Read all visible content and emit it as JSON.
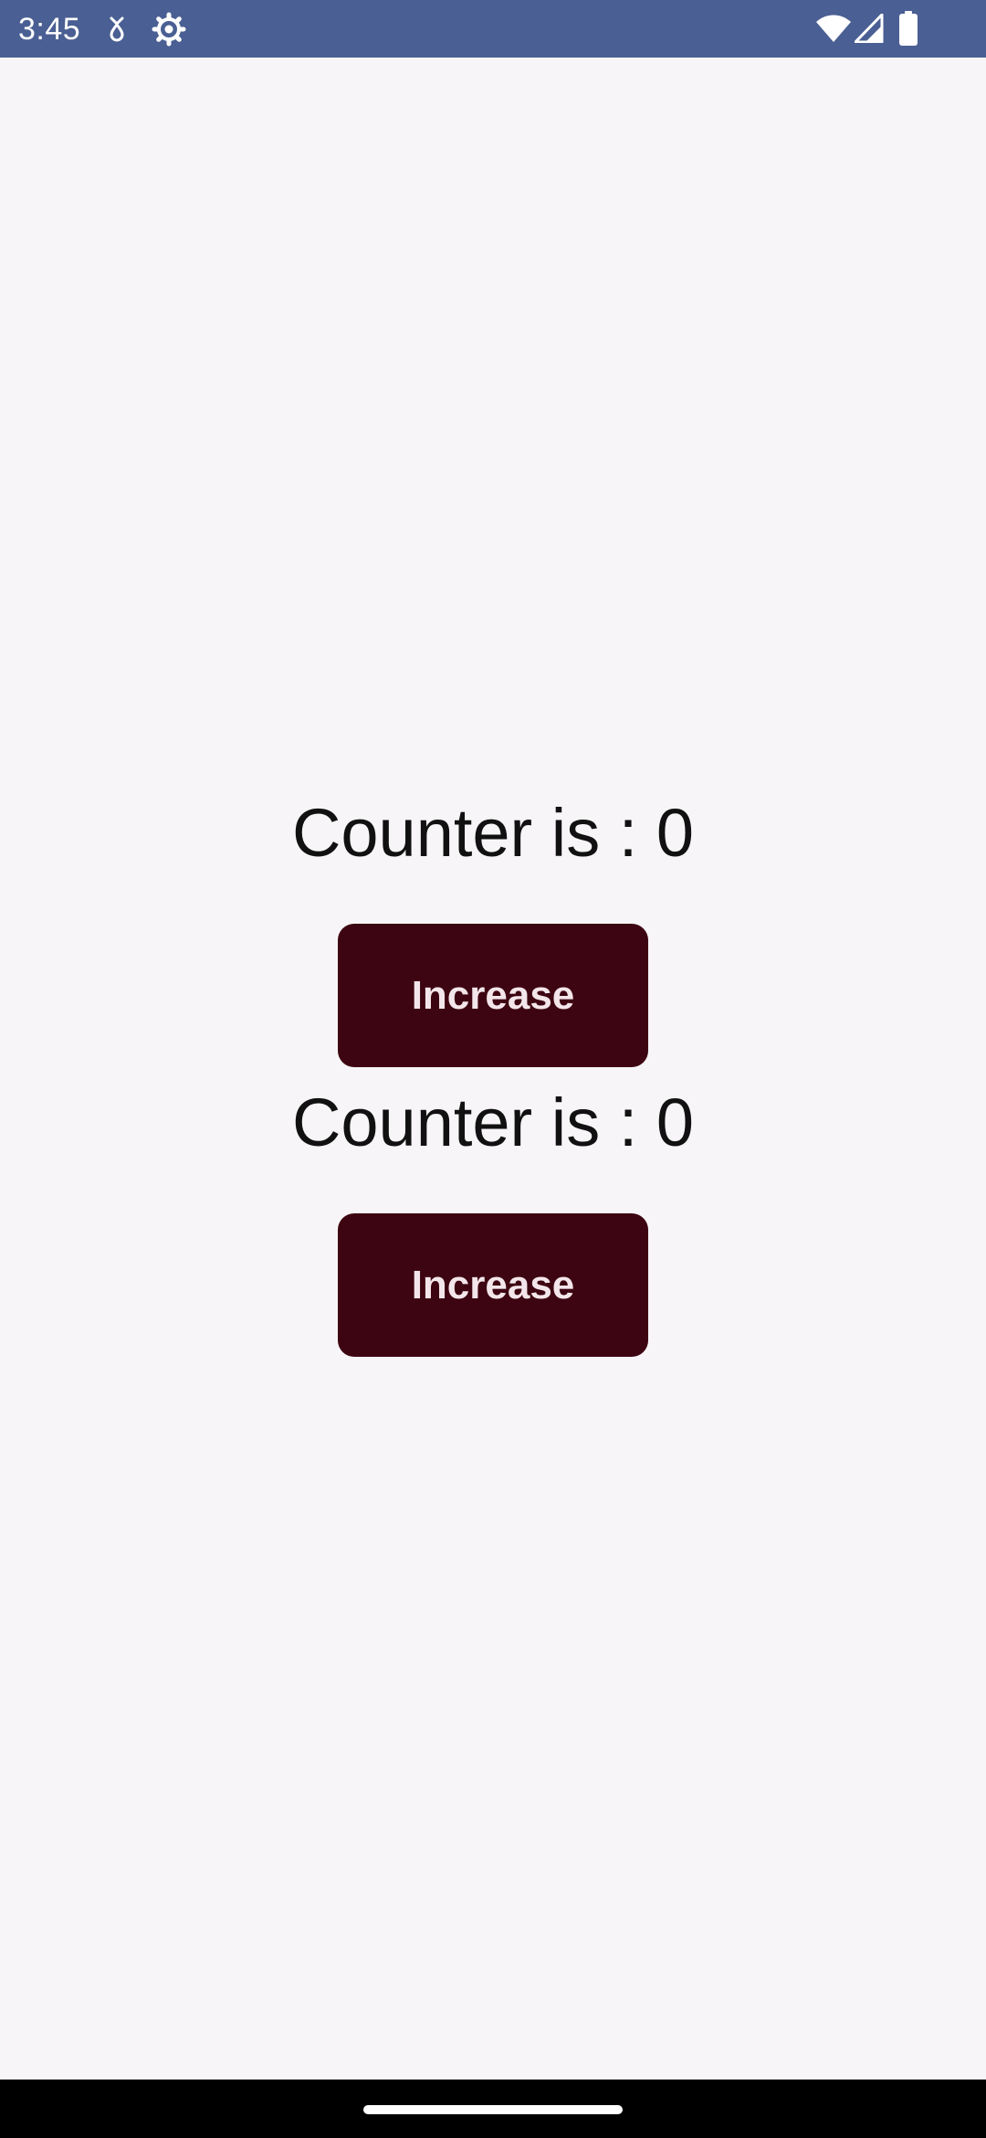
{
  "status_bar": {
    "time": "3:45",
    "background": "#4a5f93",
    "icons": [
      "notification-drop-icon",
      "settings-gear-icon",
      "wifi-icon",
      "cellular-signal-icon",
      "battery-icon"
    ]
  },
  "counters": [
    {
      "label": "Counter is : 0",
      "button_label": "Increase"
    },
    {
      "label": "Counter is : 0",
      "button_label": "Increase"
    }
  ],
  "colors": {
    "button": "#3d0411",
    "button_text": "#f3e6ea",
    "page_background": "#f7f5f7",
    "text": "#111111"
  }
}
